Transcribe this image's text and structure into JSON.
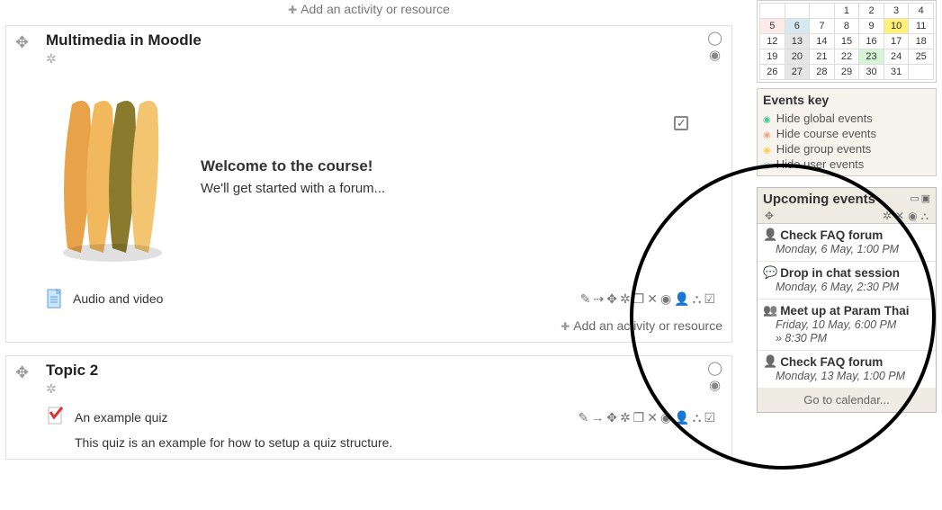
{
  "main": {
    "add_activity_label": "Add an activity or resource",
    "sections": [
      {
        "title": "Multimedia in Moodle",
        "welcome_heading": "Welcome to the course!",
        "welcome_sub": "We'll get started with a forum...",
        "resource_label": "Audio and video"
      },
      {
        "title": "Topic 2",
        "activity_label": "An example quiz",
        "activity_desc": "This quiz is an example for how to setup a quiz structure."
      }
    ]
  },
  "calendar": {
    "weeks": [
      [
        "",
        "",
        "",
        "1",
        "2",
        "3",
        "4"
      ],
      [
        "5",
        "6",
        "7",
        "8",
        "9",
        "10",
        "11"
      ],
      [
        "12",
        "13",
        "14",
        "15",
        "16",
        "17",
        "18"
      ],
      [
        "19",
        "20",
        "21",
        "22",
        "23",
        "24",
        "25"
      ],
      [
        "26",
        "27",
        "28",
        "29",
        "30",
        "31",
        ""
      ]
    ]
  },
  "events_key": {
    "title": "Events key",
    "items": [
      "Hide global events",
      "Hide course events",
      "Hide group events",
      "Hide user events"
    ]
  },
  "upcoming": {
    "title": "Upcoming events",
    "items": [
      {
        "icon": "user",
        "title": "Check FAQ forum",
        "time": "Monday, 6 May, 1:00 PM"
      },
      {
        "icon": "chat",
        "title": "Drop in chat session",
        "time": "Monday, 6 May, 2:30 PM"
      },
      {
        "icon": "group",
        "title": "Meet up at Param Thai",
        "time": "Friday, 10 May, 6:00 PM",
        "time2": "» 8:30 PM"
      },
      {
        "icon": "user",
        "title": "Check FAQ forum",
        "time": "Monday, 13 May, 1:00 PM"
      }
    ],
    "footer": "Go to calendar..."
  }
}
